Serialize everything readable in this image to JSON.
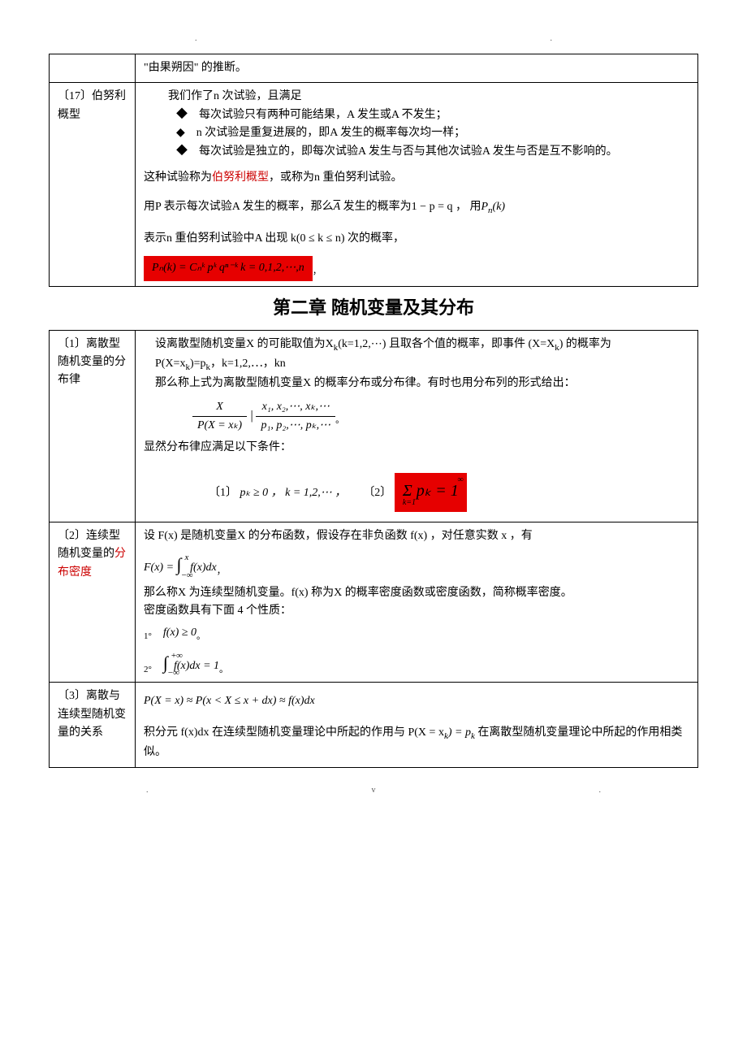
{
  "top": {
    "dot1": ".",
    "dot2": "."
  },
  "table1": {
    "r0": {
      "lbl": "",
      "c": "\"由果朔因\" 的推断。"
    },
    "r1": {
      "lbl": "〔17〕伯努利概型",
      "line1": "我们作了n 次试验，且满足",
      "b1": "每次试验只有两种可能结果，A 发生或A 不发生；",
      "b2": "n 次试验是重复进展的，即A 发生的概率每次均一样；",
      "b3": "每次试验是独立的，即每次试验A 发生与否与其他次试验A 发生与否是互不影响的。",
      "line2a": "这种试验称为",
      "line2red": "伯努利概型",
      "line2b": "，或称为n 重伯努利试验。",
      "line3a": "用P 表示每次试验A 发生的概率，那么",
      "line3aover": "A",
      "line3b": " 发生的概率为1 − p = q ， 用",
      "line3pn": "P",
      "line3pn_sub": "n",
      "line3pn_arg": "(k)",
      "line4a": "表示n 重伯努利试验中A 出现 k(0 ≤ k ≤ n) 次的概率，",
      "formula": "Pₙ(k) = Cₙᵏ pᵏ qⁿ⁻ᵏ     k = 0,1,2,⋯,n",
      "comma": "，"
    }
  },
  "chapter": "第二章   随机变量及其分布",
  "table2": {
    "r1": {
      "lbl": "〔1〕离散型随机变量的分布律",
      "p1a": "　设离散型随机变量X 的可能取值为X",
      "p1sub": "k",
      "p1b": "(k=1,2,⋯) 且取各个值的概率，即事件 (X=X",
      "p1sub2": "k",
      "p1c": ") 的概率为",
      "p2a": "　P(X=x",
      "p2sub": "k",
      "p2b": ")=p",
      "p2sub2": "k",
      "p2c": "，k=1,2,⋯，kn",
      "p3": "　那么称上式为离散型随机变量X 的概率分布或分布律。有时也用分布列的形式给出：",
      "frac_num": "X",
      "frac_den": "P(X = xₖ)",
      "frac_bar": "|",
      "frac_num2": "x₁, x₂,⋯, xₖ,⋯",
      "frac_den2": "p₁, p₂,⋯, pₖ,⋯ ",
      "period": "。",
      "p4": "显然分布律应满足以下条件：",
      "cond1_num": "〔1〕",
      "cond1": " pₖ ≥ 0 ， k = 1,2,⋯ ，",
      "cond2_num": "〔2〕",
      "cond2_sum": "Σ  pₖ = 1",
      "cond2_sub": "k=1",
      "cond2_sup": "∞"
    },
    "r2": {
      "lbl_a": "〔2〕连续型随机变量的",
      "lbl_red": "分布密度",
      "p1": "设 F(x) 是随机变量X 的分布函数，假设存在非负函数 f(x) ，对任意实数 x ，有",
      "fx_lhs": "F(x) = ",
      "fx_int": "∫",
      "fx_sup": "x",
      "fx_sub": "−∞",
      "fx_rhs": " f(x)dx",
      "comma": "，",
      "p2": "那么称X 为连续型随机变量。f(x) 称为X 的概率密度函数或密度函数，简称概率密度。",
      "p3": "密度函数具有下面 4 个性质：",
      "prop1_num": "1°",
      "prop1": "f(x) ≥ 0",
      "prop1_end": "。",
      "prop2_num": "2°",
      "prop2_int": "∫",
      "prop2_sup": "+∞",
      "prop2_sub": "−∞",
      "prop2": "f(x)dx = 1",
      "prop2_end": "。"
    },
    "r3": {
      "lbl": "〔3〕离散与连续型随机变量的关系",
      "p1": "P(X = x) ≈ P(x < X ≤ x + dx) ≈ f(x)dx",
      "p2a": "积分元 f(x)dx 在连续型随机变量理论中所起的作用与  P(X = x",
      "p2sub": "k",
      "p2b": ") = p",
      "p2sub2": "k",
      "p2c": " 在离散型随机变量理论中所起的作用相类似。"
    }
  },
  "footer": {
    "left": ".",
    "v": "v",
    "right": "."
  }
}
